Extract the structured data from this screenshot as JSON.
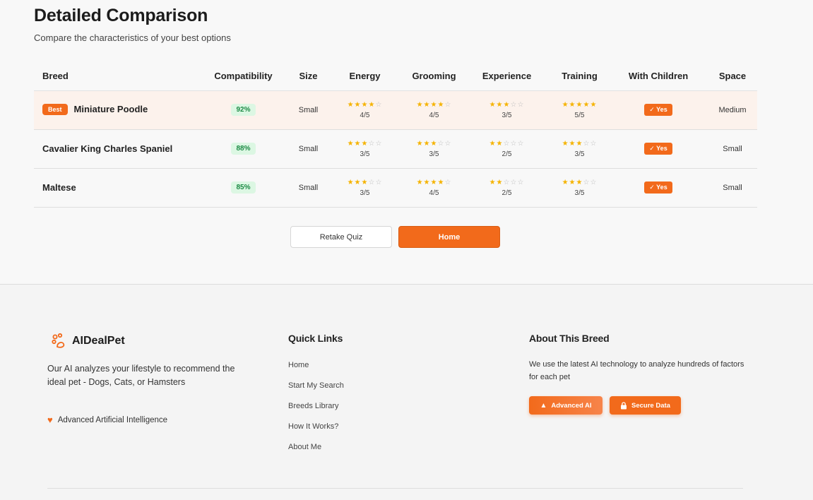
{
  "header": {
    "title": "Detailed Comparison",
    "subtitle": "Compare the characteristics of your best options"
  },
  "table": {
    "columns": [
      "Breed",
      "Compatibility",
      "Size",
      "Energy",
      "Grooming",
      "Experience",
      "Training",
      "With Children",
      "Space"
    ],
    "best_label": "Best",
    "rows": [
      {
        "breed": "Miniature Poodle",
        "best": true,
        "compatibility": "92%",
        "size": "Small",
        "energy": {
          "stars": 4,
          "text": "4/5"
        },
        "grooming": {
          "stars": 4,
          "text": "4/5"
        },
        "experience": {
          "stars": 3,
          "text": "3/5"
        },
        "training": {
          "stars": 5,
          "text": "5/5"
        },
        "children": "✓ Yes",
        "space": "Medium"
      },
      {
        "breed": "Cavalier King Charles Spaniel",
        "best": false,
        "compatibility": "88%",
        "size": "Small",
        "energy": {
          "stars": 3,
          "text": "3/5"
        },
        "grooming": {
          "stars": 3,
          "text": "3/5"
        },
        "experience": {
          "stars": 2,
          "text": "2/5"
        },
        "training": {
          "stars": 3,
          "text": "3/5"
        },
        "children": "✓ Yes",
        "space": "Small"
      },
      {
        "breed": "Maltese",
        "best": false,
        "compatibility": "85%",
        "size": "Small",
        "energy": {
          "stars": 3,
          "text": "3/5"
        },
        "grooming": {
          "stars": 4,
          "text": "4/5"
        },
        "experience": {
          "stars": 2,
          "text": "2/5"
        },
        "training": {
          "stars": 3,
          "text": "3/5"
        },
        "children": "✓ Yes",
        "space": "Small"
      }
    ]
  },
  "actions": {
    "retake_label": "Retake Quiz",
    "home_label": "Home"
  },
  "footer": {
    "brand": "AIDealPet",
    "logo_icon": "paw-icon",
    "tagline": "Our AI analyzes your lifestyle to recommend the ideal pet - Dogs, Cats, or Hamsters",
    "ai_label": "Advanced Artificial Intelligence",
    "quick_links_title": "Quick Links",
    "quick_links": [
      "Home",
      "Start My Search",
      "Breeds Library",
      "How It Works?",
      "About Me"
    ],
    "about_title": "About This Breed",
    "about_text": "We use the latest AI technology to analyze hundreds of factors for each pet",
    "badge_ai": "Advanced AI",
    "badge_secure": "Secure Data"
  },
  "colors": {
    "accent": "#f26a1b",
    "star": "#f5b301",
    "compat_bg": "#dcf7e3",
    "compat_text": "#1d8a45",
    "best_row_bg": "#fcf2ec"
  }
}
